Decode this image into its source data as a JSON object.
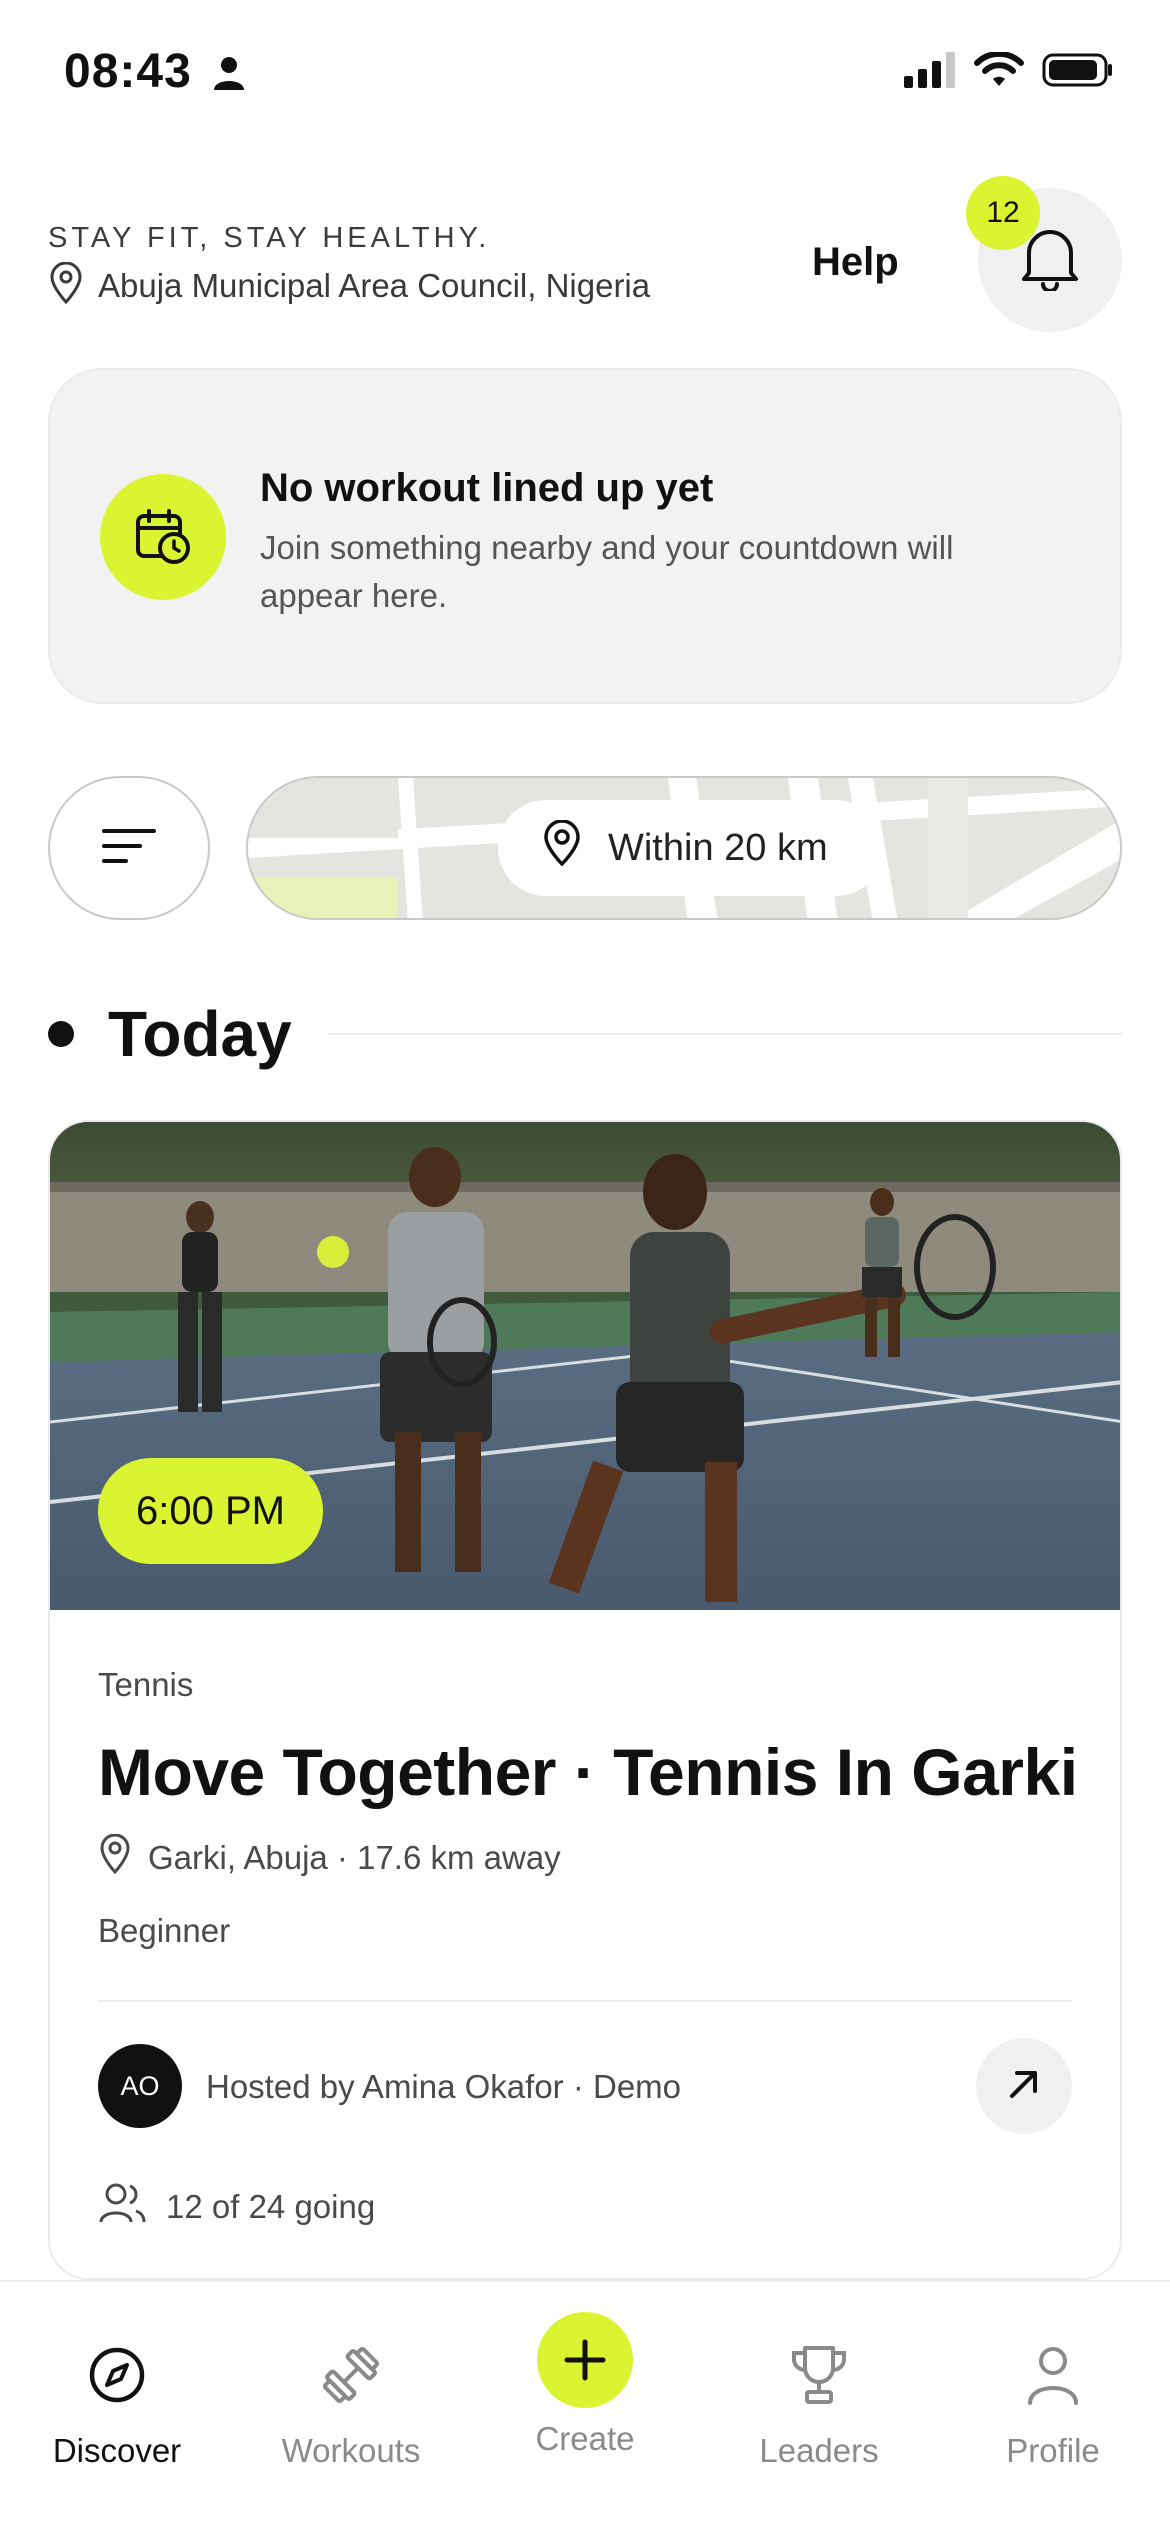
{
  "status_bar": {
    "time": "08:43"
  },
  "header": {
    "tagline": "STAY FIT, STAY HEALTHY.",
    "location": "Abuja Municipal Area Council, Nigeria",
    "help_label": "Help",
    "notification_count": "12"
  },
  "empty_state": {
    "title": "No workout lined up yet",
    "subtitle": "Join something nearby and your countdown will appear here."
  },
  "filters": {
    "radius_label": "Within 20 km"
  },
  "section": {
    "title": "Today"
  },
  "event": {
    "time": "6:00 PM",
    "category": "Tennis",
    "title": "Move Together · Tennis In Garki",
    "location": "Garki, Abuja · 17.6 km away",
    "level": "Beginner",
    "host_initials": "AO",
    "host_text": "Hosted by Amina Okafor · Demo",
    "attendance": "12 of 24 going"
  },
  "nav": {
    "items": [
      {
        "label": "Discover",
        "icon": "compass-icon",
        "active": true
      },
      {
        "label": "Workouts",
        "icon": "dumbbell-icon",
        "active": false
      },
      {
        "label": "Create",
        "icon": "plus-icon",
        "active": false
      },
      {
        "label": "Leaders",
        "icon": "trophy-icon",
        "active": false
      },
      {
        "label": "Profile",
        "icon": "user-icon",
        "active": false
      }
    ]
  },
  "colors": {
    "accent": "#d9f532",
    "text": "#111111",
    "muted": "#8a8a8a"
  }
}
